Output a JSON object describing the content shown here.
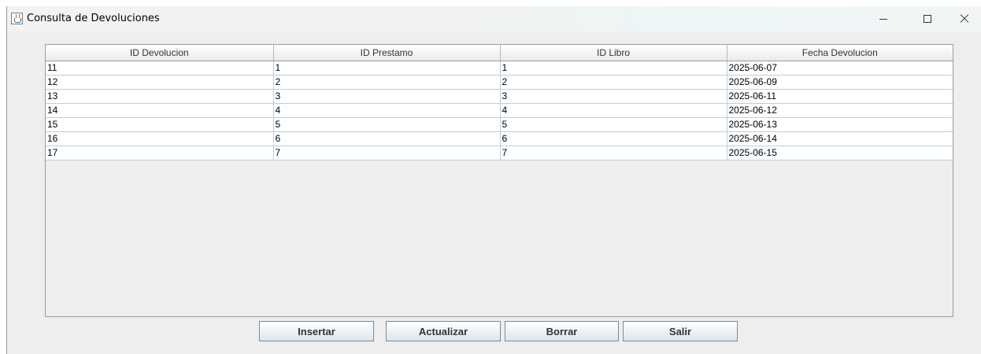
{
  "window": {
    "title": "Consulta de Devoluciones"
  },
  "table": {
    "columns": [
      "ID Devolucion",
      "ID Prestamo",
      "ID Libro",
      "Fecha Devolucion"
    ],
    "rows": [
      [
        "11",
        "1",
        "1",
        "2025-06-07"
      ],
      [
        "12",
        "2",
        "2",
        "2025-06-09"
      ],
      [
        "13",
        "3",
        "3",
        "2025-06-11"
      ],
      [
        "14",
        "4",
        "4",
        "2025-06-12"
      ],
      [
        "15",
        "5",
        "5",
        "2025-06-13"
      ],
      [
        "16",
        "6",
        "6",
        "2025-06-14"
      ],
      [
        "17",
        "7",
        "7",
        "2025-06-15"
      ]
    ]
  },
  "buttons": {
    "insertar": "Insertar",
    "actualizar": "Actualizar",
    "borrar": "Borrar",
    "salir": "Salir"
  }
}
